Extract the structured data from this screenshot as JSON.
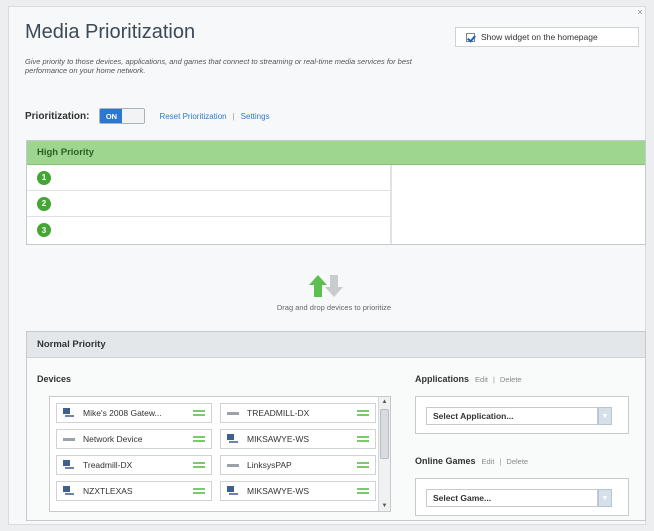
{
  "page": {
    "title": "Media Prioritization",
    "description": "Give priority to those devices, applications, and games that connect to streaming or real-time media services for best performance on your home network.",
    "widget_checkbox_label": "Show widget on the homepage"
  },
  "prioritization": {
    "label": "Prioritization:",
    "toggle_state": "ON",
    "reset_link": "Reset Prioritization",
    "separator": "|",
    "settings_link": "Settings"
  },
  "high_priority": {
    "header": "High Priority",
    "slots": [
      "1",
      "2",
      "3"
    ]
  },
  "drag": {
    "hint": "Drag and drop devices to prioritize"
  },
  "normal_priority": {
    "header": "Normal Priority",
    "devices_label": "Devices",
    "devices": [
      {
        "name": "Mike's 2008 Gatew...",
        "icon": "computer-icon"
      },
      {
        "name": "TREADMILL-DX",
        "icon": "network-device-icon"
      },
      {
        "name": "Network Device",
        "icon": "network-device-icon"
      },
      {
        "name": "MIKSAWYE-WS",
        "icon": "computer-icon"
      },
      {
        "name": "Treadmill-DX",
        "icon": "computer-icon"
      },
      {
        "name": "LinksysPAP",
        "icon": "network-device-icon"
      },
      {
        "name": "NZXTLEXAS",
        "icon": "computer-icon"
      },
      {
        "name": "MIKSAWYE-WS",
        "icon": "computer-icon"
      }
    ],
    "applications": {
      "label": "Applications",
      "edit": "Edit",
      "separator": "|",
      "delete": "Delete",
      "select_value": "Select Application..."
    },
    "online_games": {
      "label": "Online Games",
      "edit": "Edit",
      "separator": "|",
      "delete": "Delete",
      "select_value": "Select Game..."
    }
  },
  "colors": {
    "accent_blue": "#2a78d1",
    "high_priority_green": "#9ed68f",
    "number_badge_green": "#45a535",
    "link_blue": "#2c7bc7"
  }
}
